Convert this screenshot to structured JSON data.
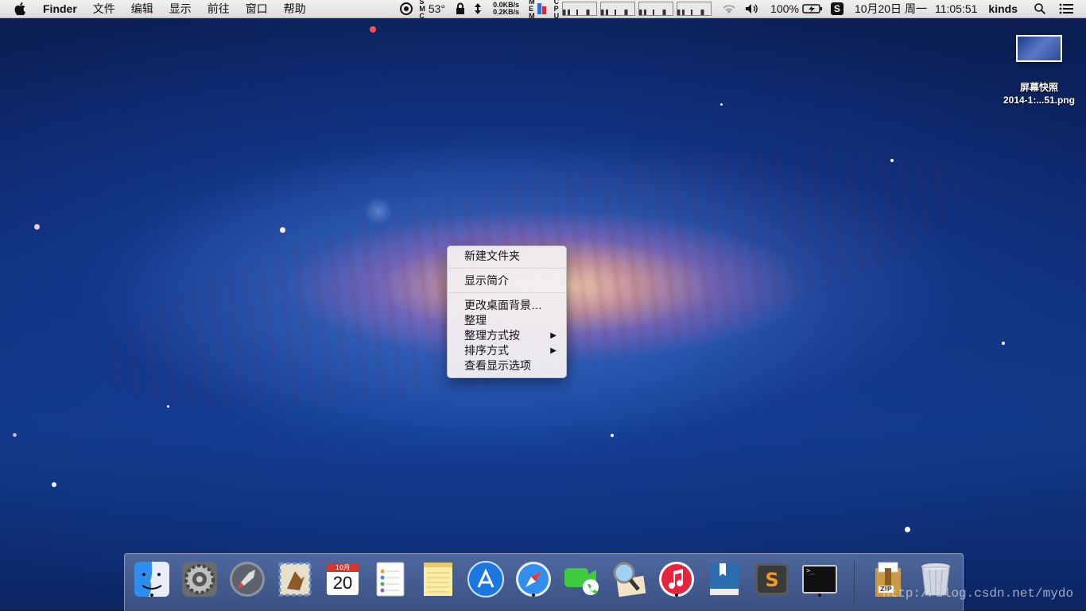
{
  "menubar": {
    "app_name": "Finder",
    "menus": [
      "文件",
      "编辑",
      "显示",
      "前往",
      "窗口",
      "帮助"
    ],
    "status": {
      "temperature": "53°",
      "net_up": "0.0KB/s",
      "net_down": "0.2KB/s",
      "battery": "100%",
      "date": "10月20日 周一",
      "time": "11:05:51",
      "user": "kinds"
    }
  },
  "desktop_file": {
    "label_line1": "屏幕快照",
    "label_line2": "2014-1:...51.png"
  },
  "context_menu": {
    "items": [
      "新建文件夹",
      "显示简介",
      "更改桌面背景…",
      "整理",
      "整理方式按",
      "排序方式",
      "查看显示选项"
    ],
    "submenu_arrow": "▶"
  },
  "dock": {
    "calendar_month": "10月",
    "calendar_day": "20",
    "terminal_prompt": ">_",
    "archive_label": "ZIP",
    "icons": [
      "finder-icon",
      "system-preferences-icon",
      "launchpad-icon",
      "mail-icon",
      "calendar-icon",
      "reminders-icon",
      "notes-icon",
      "app-store-icon",
      "safari-icon",
      "facetime-icon",
      "preview-icon",
      "itunes-icon",
      "dictionary-icon",
      "sublime-text-icon",
      "terminal-icon",
      "archive-icon",
      "trash-icon"
    ]
  },
  "watermark": "http://blog.csdn.net/mydo"
}
